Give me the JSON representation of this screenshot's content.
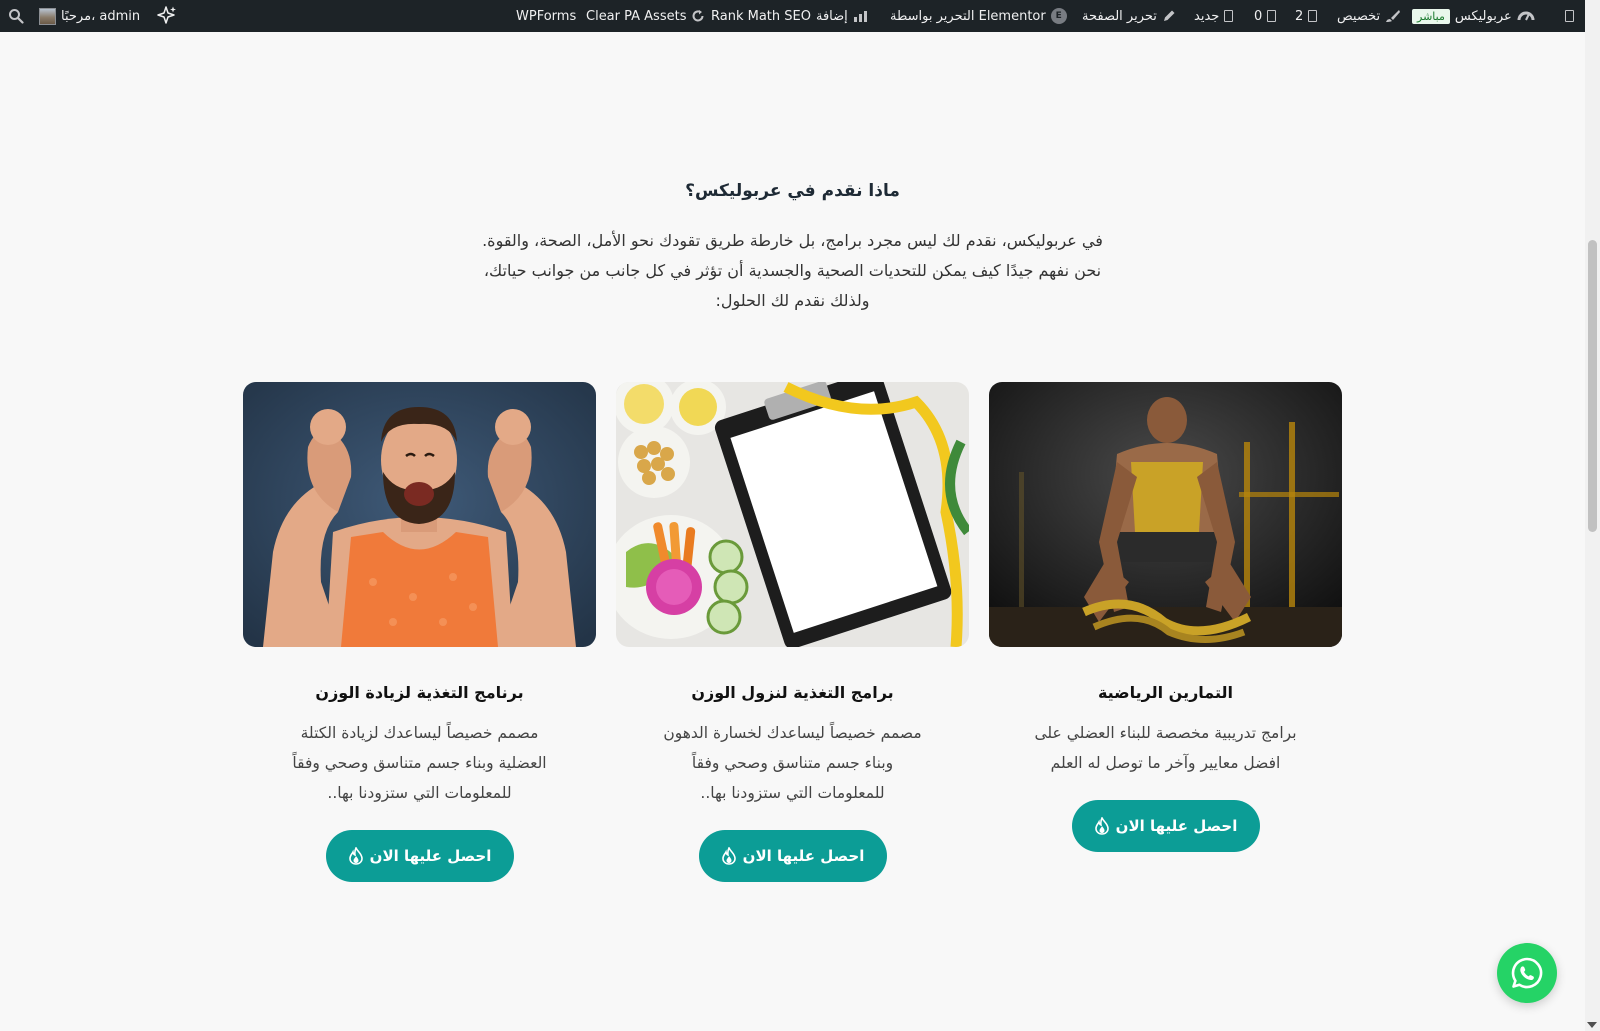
{
  "admin_bar": {
    "site_name": "عربوليكس",
    "live_badge": "مباشر",
    "customize": "تخصيص",
    "updates_count": "2",
    "comments_count": "0",
    "new": "جديد",
    "edit_page": "تحرير الصفحة",
    "elementor": "التحرير بواسطة Elementor",
    "rank_math": "Rank Math SEO",
    "add_label": "إضافة",
    "clear_assets": "Clear PA Assets",
    "wpforms": "WPForms",
    "greeting": "مرحبًا، admin"
  },
  "section": {
    "title": "ماذا نقدم في عربوليكس؟",
    "intro_lines": [
      "في عربوليكس، نقدم لك ليس مجرد برامج، بل خارطة طريق تقودك نحو الأمل، الصحة، والقوة.",
      "نحن نفهم جيدًا كيف يمكن للتحديات الصحية والجسدية أن تؤثر في كل جانب من جوانب حياتك،",
      "ولذلك نقدم لك الحلول:"
    ]
  },
  "cards": [
    {
      "title": "التمارين الرياضية",
      "desc_lines": [
        "برامج تدريبية مخصصة للبناء العضلي على",
        "افضل معايير وآخر ما توصل له العلم"
      ],
      "cta": "احصل عليها الان"
    },
    {
      "title": "برامج التغذية لنزول الوزن",
      "desc_lines": [
        "مصمم خصيصاً ليساعدك لخسارة الدهون",
        "وبناء جسم متناسق وصحي وفقاً",
        "للمعلومات التي ستزودنا بها.."
      ],
      "cta": "احصل عليها الان"
    },
    {
      "title": "برنامج التغذية لزيادة الوزن",
      "desc_lines": [
        "مصمم خصيصاً ليساعدك لزيادة الكتلة",
        "العضلية وبناء جسم متناسق وصحي وفقاً",
        "للمعلومات التي ستزودنا بها.."
      ],
      "cta": "احصل عليها الان"
    }
  ],
  "colors": {
    "accent": "#0c9d96",
    "admin_bar": "#1d2327",
    "whatsapp": "#25d366",
    "background": "#f8f8f8"
  },
  "icons": {
    "cta": "fire-icon",
    "float": "whatsapp-icon"
  }
}
